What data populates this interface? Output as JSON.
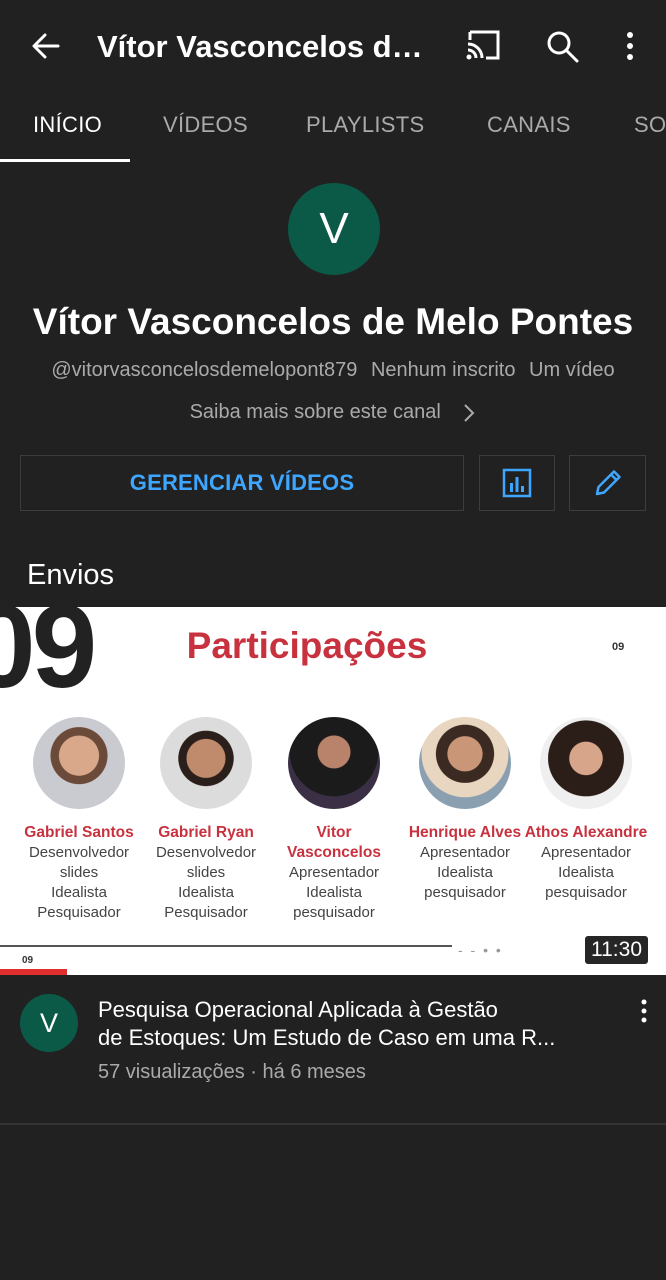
{
  "appbar": {
    "title": "Vítor Vasconcelos de Melo Pontes"
  },
  "tabs": [
    {
      "label": "INÍCIO",
      "active": true
    },
    {
      "label": "VÍDEOS",
      "active": false
    },
    {
      "label": "PLAYLISTS",
      "active": false
    },
    {
      "label": "CANAIS",
      "active": false
    },
    {
      "label": "SOBRE",
      "active": false
    }
  ],
  "channel": {
    "avatar_letter": "V",
    "name": "Vítor Vasconcelos de Melo Pontes",
    "handle": "@vitorvasconcelosdemelopont879",
    "subscribers": "Nenhum inscrito",
    "videos": "Um vídeo",
    "about": "Saiba mais sobre este canal"
  },
  "actions": {
    "manage_label": "GERENCIAR VÍDEOS"
  },
  "section": {
    "title": "Envios"
  },
  "video": {
    "thumbnail": {
      "big_number": "09",
      "slide_title": "Participações",
      "slide_number": "09",
      "bottom_number": "09",
      "duration": "11:30",
      "people": [
        {
          "name": "Gabriel Santos",
          "roles": [
            "Desenvolvedor",
            "slides",
            "Idealista",
            "Pesquisador"
          ]
        },
        {
          "name": "Gabriel Ryan",
          "roles": [
            "Desenvolvedor",
            "slides",
            "Idealista",
            "Pesquisador"
          ]
        },
        {
          "name": "Vitor Vasconcelos",
          "roles": [
            "Apresentador",
            "Idealista",
            "pesquisador"
          ]
        },
        {
          "name": "Henrique Alves",
          "roles": [
            "Apresentador",
            "Idealista",
            "pesquisador"
          ]
        },
        {
          "name": "Athos Alexandre",
          "roles": [
            "Apresentador",
            "Idealista",
            "pesquisador"
          ]
        }
      ]
    },
    "avatar_letter": "V",
    "title_line1": "Pesquisa Operacional Aplicada à Gestão",
    "title_line2": "de Estoques: Um Estudo de Caso em uma R...",
    "meta": "57 visualizações · há 6 meses"
  },
  "colors": {
    "background": "#212121",
    "accent_blue": "#3ea6ff",
    "avatar_green": "#0b5a48",
    "slide_red": "#c8323f",
    "progress_red": "#e02d2d"
  }
}
